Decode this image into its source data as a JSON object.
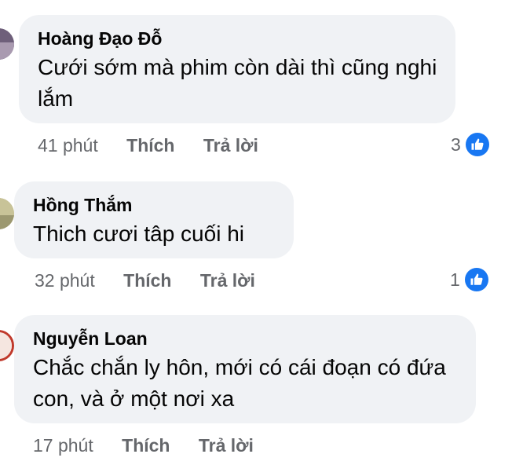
{
  "comments": [
    {
      "author": "Hoàng Đạo Đỗ",
      "text": "Cưới sớm mà phim còn dài thì cũng nghi lắm",
      "time": "41 phút",
      "like_label": "Thích",
      "reply_label": "Trả lời",
      "reaction_count": "3",
      "reaction_icon": "like-icon",
      "avatar_color": "#8a7b8f"
    },
    {
      "author": "Hồng Thắm",
      "text": "Thich cươi tâp cuối hi",
      "time": "32 phút",
      "like_label": "Thích",
      "reply_label": "Trả lời",
      "reaction_count": "1",
      "reaction_icon": "like-icon",
      "avatar_color": "#b9b48a"
    },
    {
      "author": "Nguyễn Loan",
      "text": "Chắc chắn ly hôn, mới có cái đoạn có đứa con, và ở một nơi xa",
      "time": "17 phút",
      "like_label": "Thích",
      "reply_label": "Trả lời",
      "avatar_color": "#c0392b"
    }
  ],
  "colors": {
    "bubble": "#f0f2f5",
    "meta_text": "#65676b",
    "like_blue": "#1877f2"
  }
}
